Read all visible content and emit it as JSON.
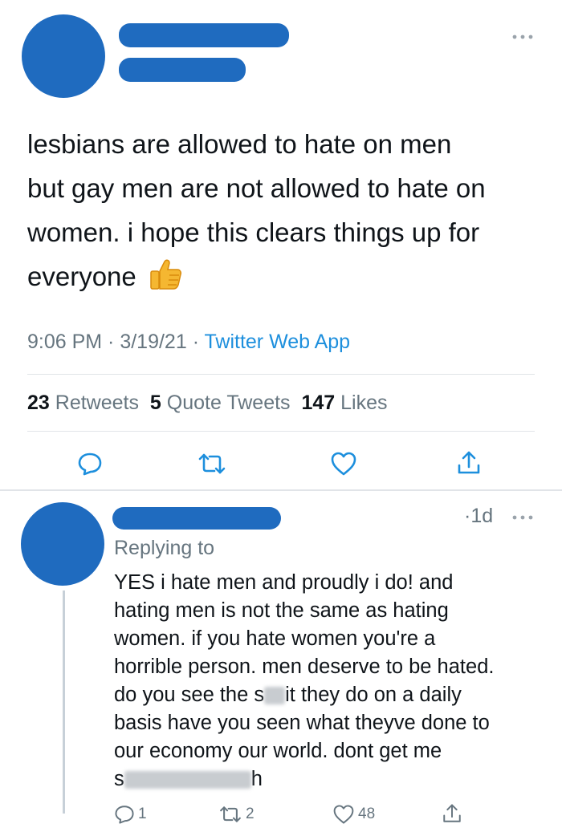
{
  "main_tweet": {
    "text_lines": [
      "lesbians are allowed to hate on men",
      "but gay men are not allowed to hate on",
      "women. i hope this clears things up for",
      "everyone"
    ],
    "emoji": "👍",
    "time": "9:06 PM",
    "date": "3/19/21",
    "source": "Twitter Web App",
    "sep": " · ",
    "retweets_count": "23",
    "retweets_label": "Retweets",
    "quotes_count": "5",
    "quotes_label": "Quote Tweets",
    "likes_count": "147",
    "likes_label": "Likes",
    "more_icon": "more-icon"
  },
  "reply": {
    "age": "1d",
    "age_dot": "·",
    "replying_label": "Replying to",
    "text_lines": [
      "YES i hate men and proudly i do! and",
      "hating men is not the same as hating",
      "women. if you hate women you're a",
      "horrible person. men deserve to be hated.",
      "do you see the s",
      "it they do on a daily",
      "basis have you seen what theyve done to",
      "our economy our world. dont get me",
      "s",
      "h"
    ],
    "reply_count": "1",
    "retweet_count": "2",
    "like_count": "48"
  },
  "colors": {
    "redaction": "#1f6bbf",
    "link": "#1d8fdd",
    "muted": "#66757f",
    "icon": "#1d8fdd"
  }
}
